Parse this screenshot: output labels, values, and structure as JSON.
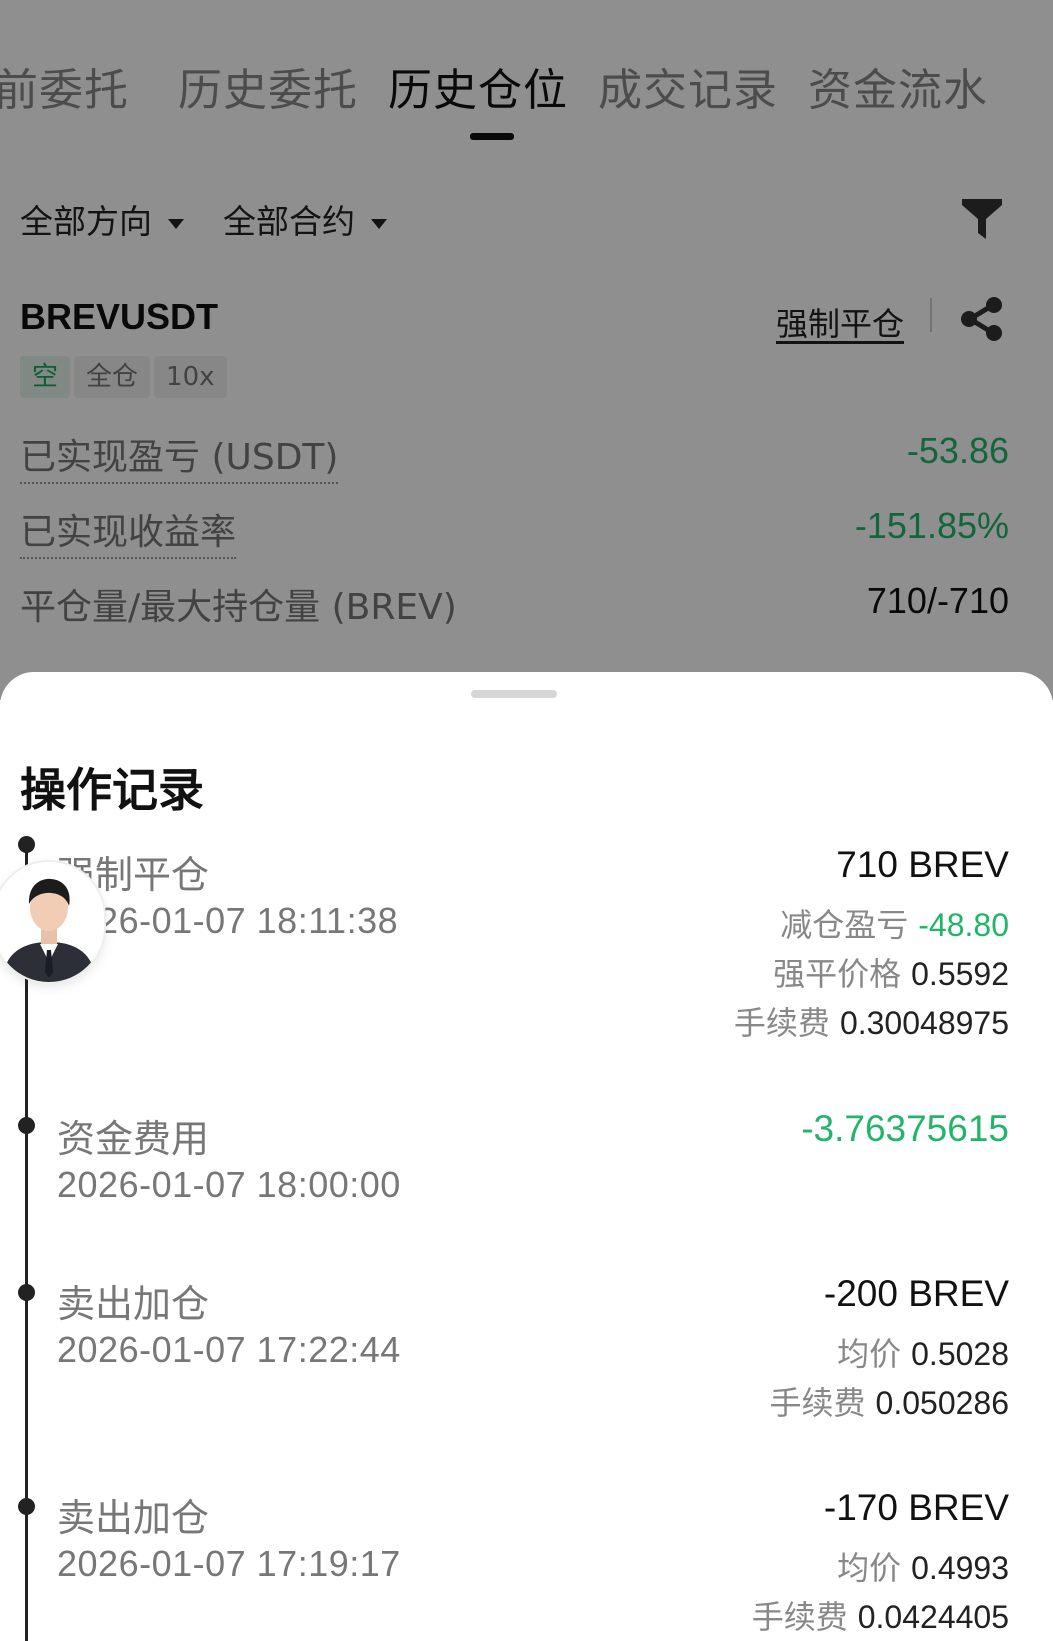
{
  "tabs": [
    "前委托",
    "历史委托",
    "历史仓位",
    "成交记录",
    "资金流水"
  ],
  "active_tab_index": 2,
  "filters": {
    "direction": "全部方向",
    "contract": "全部合约"
  },
  "position": {
    "symbol": "BREVUSDT",
    "close_type": "强制平仓",
    "tags": {
      "side": "空",
      "margin": "全仓",
      "leverage": "10x"
    },
    "stats": [
      {
        "label": "已实现盈亏 (USDT)",
        "value": "-53.86"
      },
      {
        "label": "已实现收益率",
        "value": "-151.85%"
      },
      {
        "label": "平仓量/最大持仓量 (BREV)",
        "value": "710/-710"
      }
    ]
  },
  "sheet": {
    "title": "操作记录",
    "records": [
      {
        "type": "强制平仓",
        "time": "2026-01-07 18:11:38",
        "amount": "710 BREV",
        "details": [
          {
            "label": "减仓盈亏",
            "value": "-48.80",
            "color": "#22b56a"
          },
          {
            "label": "强平价格",
            "value": "0.5592"
          },
          {
            "label": "手续费",
            "value": "0.30048975"
          }
        ]
      },
      {
        "type": "资金费用",
        "time": "2026-01-07 18:00:00",
        "amount": "-3.76375615",
        "amount_color": "#22b56a",
        "details": []
      },
      {
        "type": "卖出加仓",
        "time": "2026-01-07 17:22:44",
        "amount": "-200 BREV",
        "details": [
          {
            "label": "均价",
            "value": "0.5028"
          },
          {
            "label": "手续费",
            "value": "0.050286"
          }
        ]
      },
      {
        "type": "卖出加仓",
        "time": "2026-01-07 17:19:17",
        "amount": "-170 BREV",
        "details": [
          {
            "label": "均价",
            "value": "0.4993"
          },
          {
            "label": "手续费",
            "value": "0.0424405"
          }
        ]
      }
    ]
  },
  "icons": {
    "filter": "filter-icon",
    "share": "share-icon",
    "avatar": "user-avatar"
  },
  "colors": {
    "positive_green": "#22b56a",
    "short_tag_green": "#1fa35c"
  }
}
